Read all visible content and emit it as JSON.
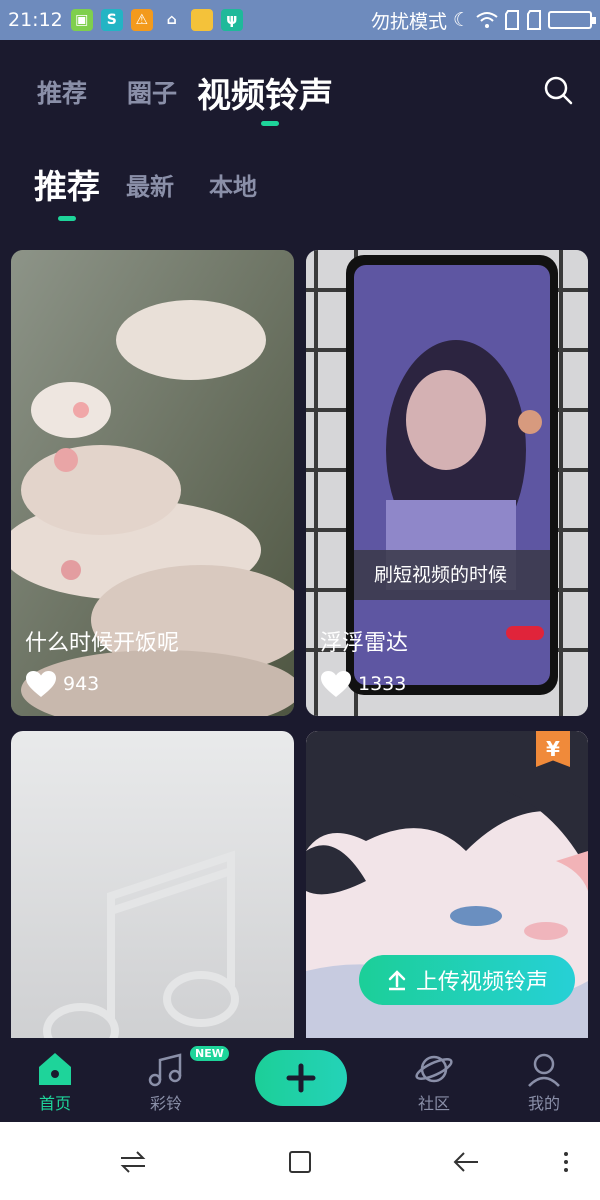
{
  "status": {
    "time": "21:12",
    "mode": "勿扰模式"
  },
  "top_tabs": [
    {
      "label": "推荐"
    },
    {
      "label": "圈子"
    },
    {
      "label": "视频铃声"
    }
  ],
  "sub_tabs": [
    {
      "label": "推荐"
    },
    {
      "label": "最新"
    },
    {
      "label": "本地"
    }
  ],
  "cards": [
    {
      "title": "什么时候开饭呢",
      "likes": "943"
    },
    {
      "title": "浮浮雷达",
      "likes": "1333",
      "overlay_text": "刷短视频的时候"
    },
    {
      "title": "",
      "likes": ""
    },
    {
      "title": "",
      "likes": "",
      "badge": "¥"
    }
  ],
  "upload_button": {
    "label": "上传视频铃声"
  },
  "bottom_nav": [
    {
      "label": "首页"
    },
    {
      "label": "彩铃",
      "badge": "NEW"
    },
    {
      "label": "社区"
    },
    {
      "label": "我的"
    }
  ],
  "colors": {
    "accent": "#1ed49a",
    "background": "#1b1a2e",
    "statusbar": "#6e8bbd"
  }
}
